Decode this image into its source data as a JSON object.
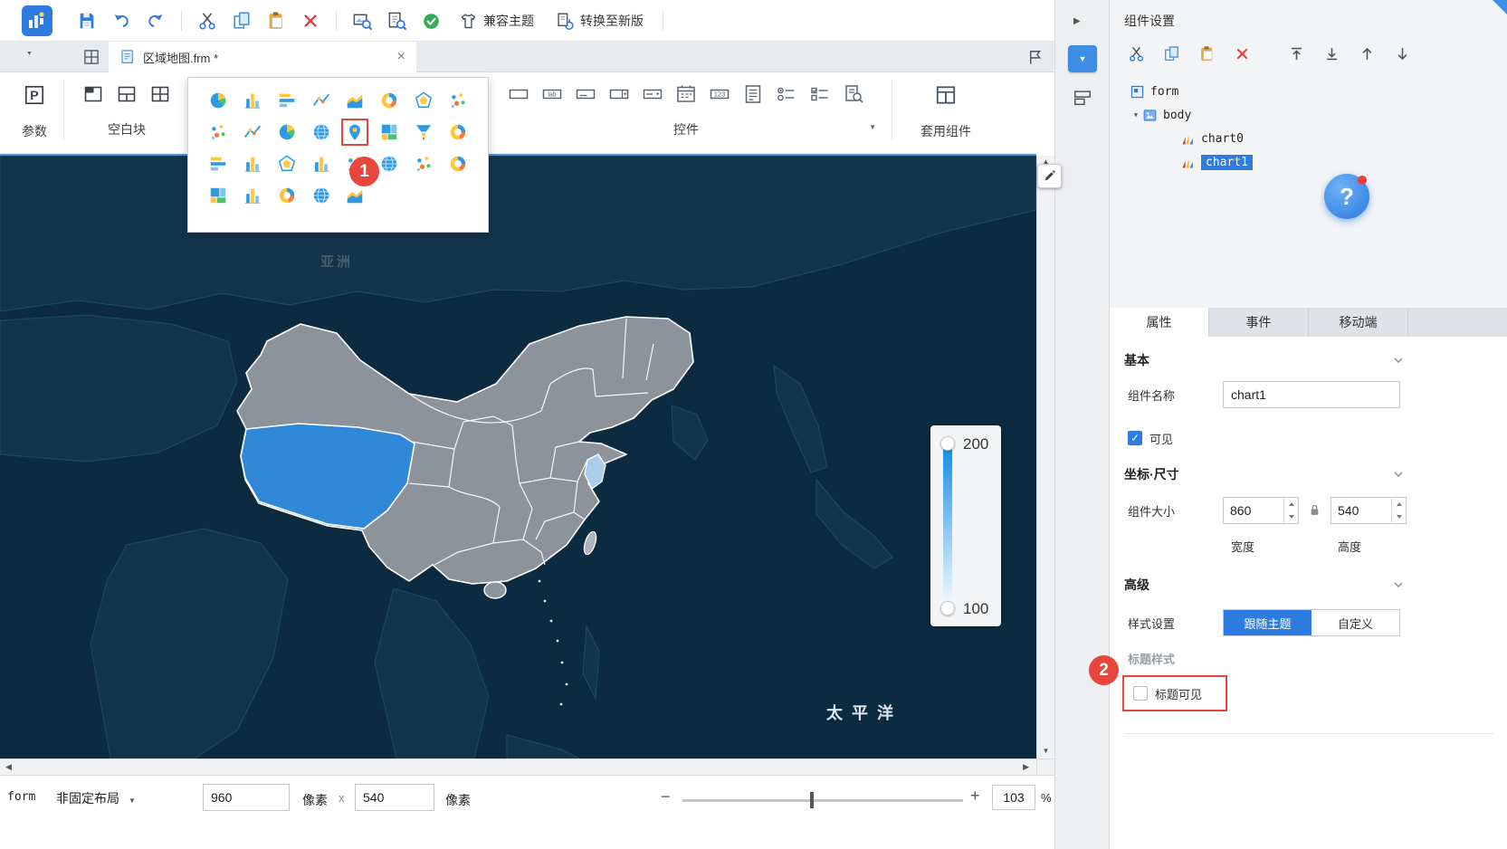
{
  "glyphs": {
    "caret_down": "▼",
    "caret_up": "▲",
    "caret_left": "◀",
    "caret_right": "▶",
    "close": "×",
    "check": "✓",
    "question": "?",
    "minus": "−",
    "plus": "+",
    "p": "P",
    "lab": "lab",
    "num123": "123",
    "mult": "x"
  },
  "toolbar": {
    "compat_theme": "兼容主题",
    "convert_new": "转换至新版"
  },
  "tabbar": {
    "tab_title": "区域地图.frm *"
  },
  "ribbon": {
    "param_label": "参数",
    "blank_label": "空白块",
    "controls_label": "控件",
    "apply_label": "套用组件"
  },
  "chart_popup": {
    "items": [
      {
        "name": "pie-chart-icon",
        "sym": "s-pie"
      },
      {
        "name": "column-chart-icon",
        "sym": "s-col"
      },
      {
        "name": "bar-chart-icon",
        "sym": "s-hbar"
      },
      {
        "name": "line-chart-icon",
        "sym": "s-line"
      },
      {
        "name": "area-chart-icon",
        "sym": "s-area"
      },
      {
        "name": "dashboard-chart-icon",
        "sym": "s-donut"
      },
      {
        "name": "radar-chart-icon",
        "sym": "s-radar"
      },
      {
        "name": "scatter-chart-icon",
        "sym": "s-scatter"
      },
      {
        "name": "bubble-chart-icon",
        "sym": "s-scatter"
      },
      {
        "name": "combo-chart-icon",
        "sym": "s-line"
      },
      {
        "name": "rose-pie-chart-icon",
        "sym": "s-pie"
      },
      {
        "name": "world-map-chart-icon",
        "sym": "s-globe"
      },
      {
        "name": "point-map-chart-icon",
        "sym": "s-pin",
        "boxed": true
      },
      {
        "name": "treemap-chart-icon",
        "sym": "s-grid"
      },
      {
        "name": "funnel-chart-icon",
        "sym": "s-funnel"
      },
      {
        "name": "gis-map-chart-icon",
        "sym": "s-donut"
      },
      {
        "name": "gantt-chart-icon",
        "sym": "s-hbar"
      },
      {
        "name": "stock-chart-icon",
        "sym": "s-col"
      },
      {
        "name": "structure-chart-icon",
        "sym": "s-radar"
      },
      {
        "name": "multi-axis-chart-icon",
        "sym": "s-col"
      },
      {
        "name": "milestone-chart-icon",
        "sym": "s-scatter"
      },
      {
        "name": "earth-chart-icon",
        "sym": "s-globe"
      },
      {
        "name": "custom-chart-icon",
        "sym": "s-scatter"
      },
      {
        "name": "ring-chart-icon",
        "sym": "s-donut"
      },
      {
        "name": "frame-chart-icon",
        "sym": "s-grid"
      },
      {
        "name": "word-cloud-chart-icon",
        "sym": "s-col"
      },
      {
        "name": "spiral-chart-icon",
        "sym": "s-donut"
      },
      {
        "name": "circle-packing-chart-icon",
        "sym": "s-globe"
      },
      {
        "name": "layer-area-chart-icon",
        "sym": "s-area"
      }
    ]
  },
  "controls": {
    "items": [
      {
        "name": "text-field-icon",
        "sym": "s-ctl-rect"
      },
      {
        "name": "label-widget-icon",
        "sym": "s-ctl-lab"
      },
      {
        "name": "text-area-icon",
        "sym": "s-ctl-line"
      },
      {
        "name": "dropdown-icon",
        "sym": "s-ctl-drop"
      },
      {
        "name": "combo-box-icon",
        "sym": "s-ctl-combo"
      },
      {
        "name": "date-picker-icon",
        "sym": "s-ctl-cal"
      },
      {
        "name": "number-field-icon",
        "sym": "s-ctl-123"
      },
      {
        "name": "rich-text-icon",
        "sym": "s-ctl-doc"
      },
      {
        "name": "radio-group-icon",
        "sym": "s-ctl-radio"
      },
      {
        "name": "checkbox-group-icon",
        "sym": "s-ctl-check"
      },
      {
        "name": "query-widget-icon",
        "sym": "s-ctl-query"
      }
    ]
  },
  "map": {
    "asia_label": "亚洲",
    "pacific_label": "太平洋",
    "legend_max": "200",
    "legend_min": "100"
  },
  "annotations": {
    "step1": "1",
    "step2": "2"
  },
  "panel": {
    "title": "组件设置",
    "tree": [
      {
        "name": "tree-item-form",
        "label": "form",
        "sym": "s-form",
        "indent": 0,
        "exp": ""
      },
      {
        "name": "tree-item-body",
        "label": "body",
        "sym": "s-body",
        "indent": 1,
        "exp": "▼"
      },
      {
        "name": "tree-item-chart0",
        "label": "chart0",
        "sym": "s-chartmini",
        "indent": 2,
        "exp": ""
      },
      {
        "name": "tree-item-chart1",
        "label": "chart1",
        "sym": "s-chartmini",
        "indent": 2,
        "exp": "",
        "selected": true
      }
    ],
    "tabs": [
      {
        "name": "tab-properties",
        "label": "属性",
        "selected": true
      },
      {
        "name": "tab-events",
        "label": "事件"
      },
      {
        "name": "tab-mobile",
        "label": "移动端"
      }
    ],
    "basic_section": "基本",
    "name_label": "组件名称",
    "name_value": "chart1",
    "visible_label": "可见",
    "coord_section": "坐标·尺寸",
    "size_label": "组件大小",
    "width_value": "860",
    "height_value": "540",
    "width_label": "宽度",
    "height_label": "高度",
    "advanced_section": "高级",
    "style_label": "样式设置",
    "style_follow": "跟随主题",
    "style_custom": "自定义",
    "title_style_label": "标题样式",
    "title_visible_label": "标题可见"
  },
  "statusbar": {
    "form_label": "form",
    "layout_mode": "非固定布局",
    "canvas_width": "960",
    "px_label_1": "像素",
    "canvas_height": "540",
    "px_label_2": "像素",
    "zoom_value": "103",
    "percent": "%"
  }
}
